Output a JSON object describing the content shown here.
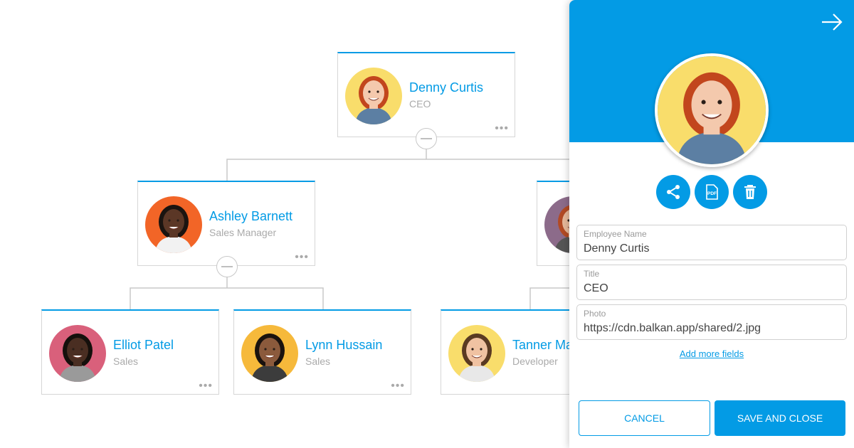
{
  "colors": {
    "accent": "#039be5",
    "line": "#c8c8c8",
    "muted": "#aaaaaa"
  },
  "org_chart": {
    "nodes": [
      {
        "id": "denny",
        "name": "Denny Curtis",
        "title": "CEO",
        "avatar_bg": "#f9dd6b",
        "skin": "#f4c9ad",
        "hair": "#c2461d",
        "shirt": "#5c7fa3"
      },
      {
        "id": "ashley",
        "name": "Ashley Barnett",
        "title": "Sales Manager",
        "avatar_bg": "#f26527",
        "skin": "#5b3726",
        "hair": "#1b1410",
        "shirt": "#f2f2f2"
      },
      {
        "id": "partial",
        "name": "",
        "title": "",
        "avatar_bg": "#8c6b8a",
        "skin": "#e6b89a",
        "hair": "#b24a24",
        "shirt": "#555555"
      },
      {
        "id": "elliot",
        "name": "Elliot Patel",
        "title": "Sales",
        "avatar_bg": "#d9607b",
        "skin": "#4a2e22",
        "hair": "#15100c",
        "shirt": "#9a9a9a"
      },
      {
        "id": "lynn",
        "name": "Lynn Hussain",
        "title": "Sales",
        "avatar_bg": "#f6b93b",
        "skin": "#8b5a3c",
        "hair": "#1a120e",
        "shirt": "#3c3c3c"
      },
      {
        "id": "tanner",
        "name": "Tanner Ma",
        "title": "Developer",
        "avatar_bg": "#f9dd6b",
        "skin": "#f0c2a2",
        "hair": "#5a3a22",
        "shirt": "#e8e8e8"
      }
    ],
    "more_icon": "more-dots-icon"
  },
  "panel": {
    "close_icon": "arrow-right-icon",
    "avatar_bg": "#f9dd6b",
    "actions": [
      {
        "id": "share",
        "icon": "share-icon"
      },
      {
        "id": "pdf",
        "icon": "pdf-icon",
        "text": "PDF"
      },
      {
        "id": "delete",
        "icon": "trash-icon"
      }
    ],
    "fields": [
      {
        "label": "Employee Name",
        "value": "Denny Curtis"
      },
      {
        "label": "Title",
        "value": "CEO"
      },
      {
        "label": "Photo",
        "value": "https://cdn.balkan.app/shared/2.jpg"
      }
    ],
    "add_more_label": "Add more fields",
    "cancel_label": "CANCEL",
    "save_label": "SAVE AND CLOSE"
  }
}
